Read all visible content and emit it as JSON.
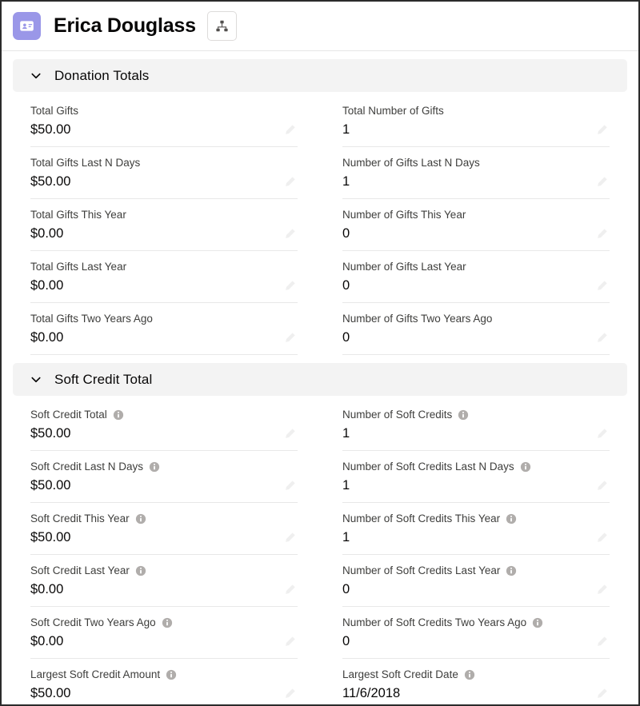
{
  "header": {
    "record_icon": "contact-card-icon",
    "title": "Erica Douglass",
    "hierarchy_button_icon": "org-hierarchy-icon"
  },
  "sections": [
    {
      "id": "donation-totals",
      "title": "Donation Totals",
      "collapse_icon": "chevron-down-icon",
      "fields": [
        {
          "label": "Total Gifts",
          "value": "$50.00",
          "info": false,
          "edit_icon": "pencil-icon"
        },
        {
          "label": "Total Number of Gifts",
          "value": "1",
          "info": false,
          "edit_icon": "pencil-icon"
        },
        {
          "label": "Total Gifts Last N Days",
          "value": "$50.00",
          "info": false,
          "edit_icon": "pencil-icon"
        },
        {
          "label": "Number of Gifts Last N Days",
          "value": "1",
          "info": false,
          "edit_icon": "pencil-icon"
        },
        {
          "label": "Total Gifts This Year",
          "value": "$0.00",
          "info": false,
          "edit_icon": "pencil-icon"
        },
        {
          "label": "Number of Gifts This Year",
          "value": "0",
          "info": false,
          "edit_icon": "pencil-icon"
        },
        {
          "label": "Total Gifts Last Year",
          "value": "$0.00",
          "info": false,
          "edit_icon": "pencil-icon"
        },
        {
          "label": "Number of Gifts Last Year",
          "value": "0",
          "info": false,
          "edit_icon": "pencil-icon"
        },
        {
          "label": "Total Gifts Two Years Ago",
          "value": "$0.00",
          "info": false,
          "edit_icon": "pencil-icon"
        },
        {
          "label": "Number of Gifts Two Years Ago",
          "value": "0",
          "info": false,
          "edit_icon": "pencil-icon"
        }
      ]
    },
    {
      "id": "soft-credit-total",
      "title": "Soft Credit Total",
      "collapse_icon": "chevron-down-icon",
      "fields": [
        {
          "label": "Soft Credit Total",
          "value": "$50.00",
          "info": true,
          "edit_icon": "pencil-icon"
        },
        {
          "label": "Number of Soft Credits",
          "value": "1",
          "info": true,
          "edit_icon": "pencil-icon"
        },
        {
          "label": "Soft Credit Last N Days",
          "value": "$50.00",
          "info": true,
          "edit_icon": "pencil-icon"
        },
        {
          "label": "Number of Soft Credits Last N Days",
          "value": "1",
          "info": true,
          "edit_icon": "pencil-icon"
        },
        {
          "label": "Soft Credit This Year",
          "value": "$50.00",
          "info": true,
          "edit_icon": "pencil-icon"
        },
        {
          "label": "Number of Soft Credits This Year",
          "value": "1",
          "info": true,
          "edit_icon": "pencil-icon"
        },
        {
          "label": "Soft Credit Last Year",
          "value": "$0.00",
          "info": true,
          "edit_icon": "pencil-icon"
        },
        {
          "label": "Number of Soft Credits Last Year",
          "value": "0",
          "info": true,
          "edit_icon": "pencil-icon"
        },
        {
          "label": "Soft Credit Two Years Ago",
          "value": "$0.00",
          "info": true,
          "edit_icon": "pencil-icon"
        },
        {
          "label": "Number of Soft Credits Two Years Ago",
          "value": "0",
          "info": true,
          "edit_icon": "pencil-icon"
        },
        {
          "label": "Largest Soft Credit Amount",
          "value": "$50.00",
          "info": true,
          "edit_icon": "pencil-icon"
        },
        {
          "label": "Largest Soft Credit Date",
          "value": "11/6/2018",
          "info": true,
          "edit_icon": "pencil-icon"
        }
      ]
    }
  ],
  "colors": {
    "record_icon_bg": "#9a97e8",
    "section_header_bg": "#f3f3f3",
    "label_text": "#3e3e3c",
    "value_text": "#080707",
    "divider": "#e8e8e8"
  }
}
